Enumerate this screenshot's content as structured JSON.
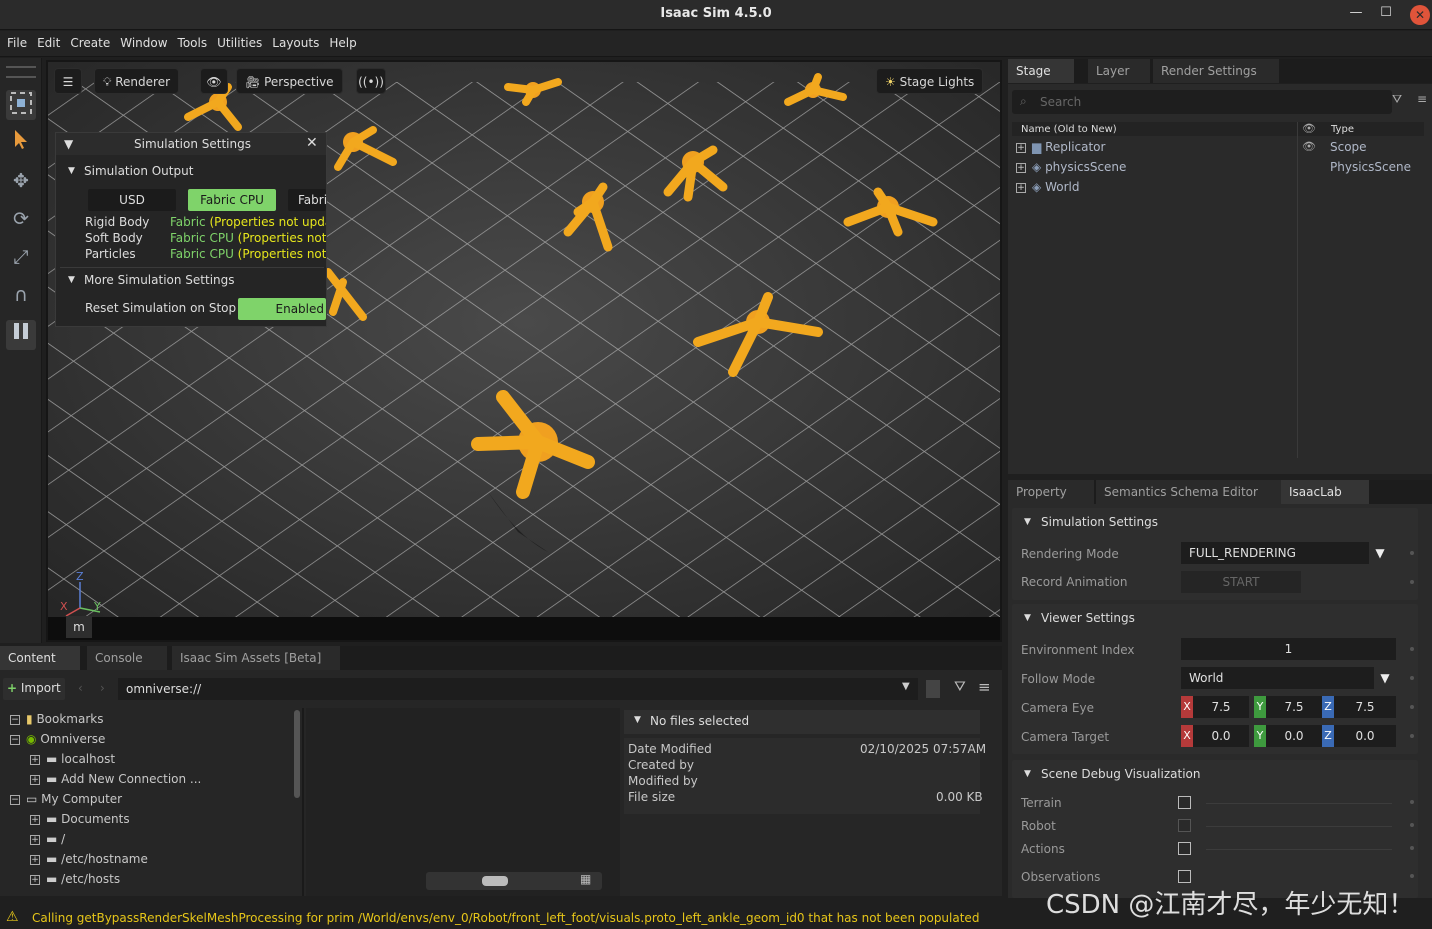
{
  "app": {
    "title": "Isaac Sim 4.5.0",
    "window_buttons": [
      "—",
      "☐",
      "✕"
    ]
  },
  "menu": [
    "File",
    "Edit",
    "Create",
    "Window",
    "Tools",
    "Utilities",
    "Layouts",
    "Help"
  ],
  "viewport": {
    "renderer_label": "Renderer",
    "camera_label": "Perspective",
    "lights_label": "Stage Lights",
    "axis_z": "Z",
    "axis_y": "Y",
    "axis_x": "X",
    "m_label": "m"
  },
  "sim_settings": {
    "title": "Simulation Settings",
    "output_section": "Simulation Output",
    "mode_buttons": [
      "USD",
      "Fabric CPU",
      "Fabri"
    ],
    "rows": [
      {
        "label": "Rigid Body",
        "value_a": "Fabric ",
        "value_b": "(Properties not upda"
      },
      {
        "label": "Soft Body",
        "value_a": "Fabric CPU ",
        "value_b": "(Properties not u"
      },
      {
        "label": "Particles",
        "value_a": "Fabric CPU ",
        "value_b": "(Properties not u"
      }
    ],
    "more_section": "More Simulation Settings",
    "reset_label": "Reset Simulation on Stop",
    "reset_value": "Enabled"
  },
  "stage": {
    "tabs": [
      "Stage",
      "Layer",
      "Render Settings"
    ],
    "search_placeholder": "Search",
    "col_name": "Name (Old to New)",
    "col_type": "Type",
    "items": [
      {
        "name": "Replicator",
        "type": "Scope"
      },
      {
        "name": "physicsScene",
        "type": "PhysicsScene"
      },
      {
        "name": "World",
        "type": ""
      }
    ]
  },
  "property": {
    "tabs": [
      "Property",
      "Semantics Schema Editor",
      "IsaacLab"
    ],
    "sim_section": "Simulation Settings",
    "rendering_mode_label": "Rendering Mode",
    "rendering_mode_value": "FULL_RENDERING",
    "record_label": "Record Animation",
    "record_button": "START",
    "viewer_section": "Viewer Settings",
    "env_index_label": "Environment Index",
    "env_index_value": "1",
    "follow_label": "Follow Mode",
    "follow_value": "World",
    "eye_label": "Camera Eye",
    "eye": [
      "7.5",
      "7.5",
      "7.5"
    ],
    "target_label": "Camera Target",
    "target": [
      "0.0",
      "0.0",
      "0.0"
    ],
    "axes": [
      "X",
      "Y",
      "Z"
    ],
    "debug_section": "Scene Debug Visualization",
    "debug_items": [
      "Terrain",
      "Robot",
      "Actions",
      "Observations"
    ]
  },
  "content": {
    "tabs": [
      "Content",
      "Console",
      "Isaac Sim Assets [Beta]"
    ],
    "import_label": "Import",
    "path": "omniverse://",
    "tree": [
      {
        "label": "Bookmarks",
        "indent": 0
      },
      {
        "label": "Omniverse",
        "indent": 0
      },
      {
        "label": "localhost",
        "indent": 1
      },
      {
        "label": "Add New Connection ...",
        "indent": 1
      },
      {
        "label": "My Computer",
        "indent": 0
      },
      {
        "label": "Documents",
        "indent": 1
      },
      {
        "label": "/",
        "indent": 1
      },
      {
        "label": "/etc/hostname",
        "indent": 1
      },
      {
        "label": "/etc/hosts",
        "indent": 1
      }
    ],
    "details": {
      "header": "No files selected",
      "date_modified_label": "Date Modified",
      "date_modified_value": "02/10/2025 07:57AM",
      "created_by_label": "Created by",
      "modified_by_label": "Modified by",
      "file_size_label": "File size",
      "file_size_value": "0.00 KB"
    }
  },
  "status": {
    "message": "Calling getBypassRenderSkelMeshProcessing for prim /World/envs/env_0/Robot/front_left_foot/visuals.proto_left_ankle_geom_id0 that has not been populated"
  },
  "watermark": "CSDN @江南才尽，年少无知！",
  "colors": {
    "accent_green": "#7fd36a",
    "warning_yellow": "#e6e61c",
    "close_red": "#e0543a"
  }
}
